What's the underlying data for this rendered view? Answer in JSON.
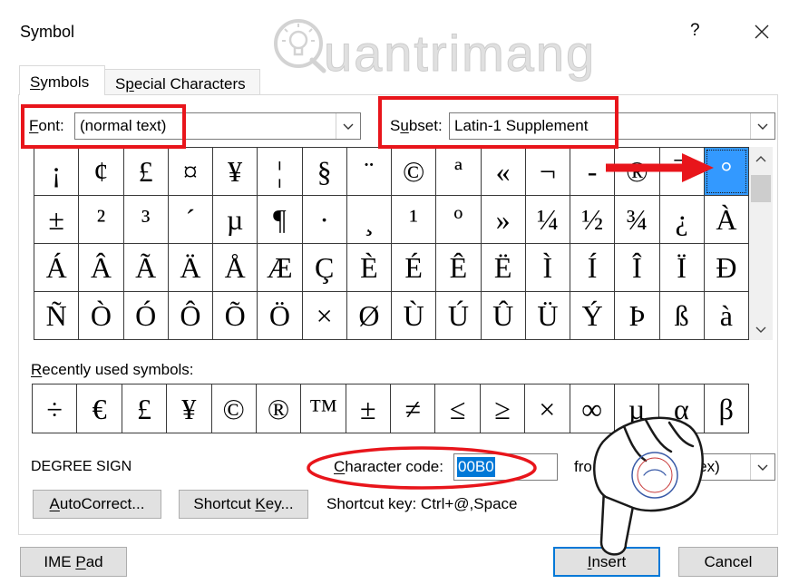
{
  "window": {
    "title": "Symbol",
    "help_label": "?"
  },
  "watermark": {
    "text": "uantrimang"
  },
  "tabs": [
    {
      "label": "Symbols",
      "active": true
    },
    {
      "label": "Special Characters",
      "active": false
    }
  ],
  "font": {
    "label": "Font:",
    "value": "(normal text)"
  },
  "subset": {
    "label": "Subset:",
    "value": "Latin-1 Supplement"
  },
  "symbol_grid": {
    "rows": [
      [
        "¡",
        "¢",
        "£",
        "¤",
        "¥",
        "¦",
        "§",
        "¨",
        "©",
        "ª",
        "«",
        "¬",
        "-",
        "®",
        "¯",
        "°"
      ],
      [
        "±",
        "²",
        "³",
        "´",
        "µ",
        "¶",
        "·",
        "¸",
        "¹",
        "º",
        "»",
        "¼",
        "½",
        "¾",
        "¿",
        "À"
      ],
      [
        "Á",
        "Â",
        "Ã",
        "Ä",
        "Å",
        "Æ",
        "Ç",
        "È",
        "É",
        "Ê",
        "Ë",
        "Ì",
        "Í",
        "Î",
        "Ï",
        "Ð"
      ],
      [
        "Ñ",
        "Ò",
        "Ó",
        "Ô",
        "Õ",
        "Ö",
        "×",
        "Ø",
        "Ù",
        "Ú",
        "Û",
        "Ü",
        "Ý",
        "Þ",
        "ß",
        "à"
      ]
    ],
    "selected": {
      "row": 0,
      "col": 15
    }
  },
  "recent": {
    "label": "Recently used symbols:",
    "symbols": [
      "÷",
      "€",
      "£",
      "¥",
      "©",
      "®",
      "™",
      "±",
      "≠",
      "≤",
      "≥",
      "×",
      "∞",
      "µ",
      "α",
      "β"
    ]
  },
  "character": {
    "name": "DEGREE SIGN",
    "code_label": "Character code:",
    "code_value": "00B0",
    "from_label": "fro",
    "from_value": "(hex)"
  },
  "buttons": {
    "autocorrect": "AutoCorrect...",
    "shortcut_key": "Shortcut Key...",
    "ime_pad": "IME Pad",
    "insert": "Insert",
    "cancel": "Cancel"
  },
  "shortcut_info": "Shortcut key: Ctrl+@,Space",
  "icons": {
    "close": "close-icon",
    "dropdown": "chevron-down-icon",
    "scroll_up": "chevron-up-icon",
    "scroll_down": "chevron-down-icon",
    "watermark_logo": "lightbulb-icon",
    "pointer": "pointing-hand-icon"
  },
  "colors": {
    "annotation": "#e8151b",
    "selection": "#3399ff",
    "text_highlight": "#0078d7",
    "default_button_border": "#0078d7",
    "grid_lines": "#3a3a3a"
  }
}
